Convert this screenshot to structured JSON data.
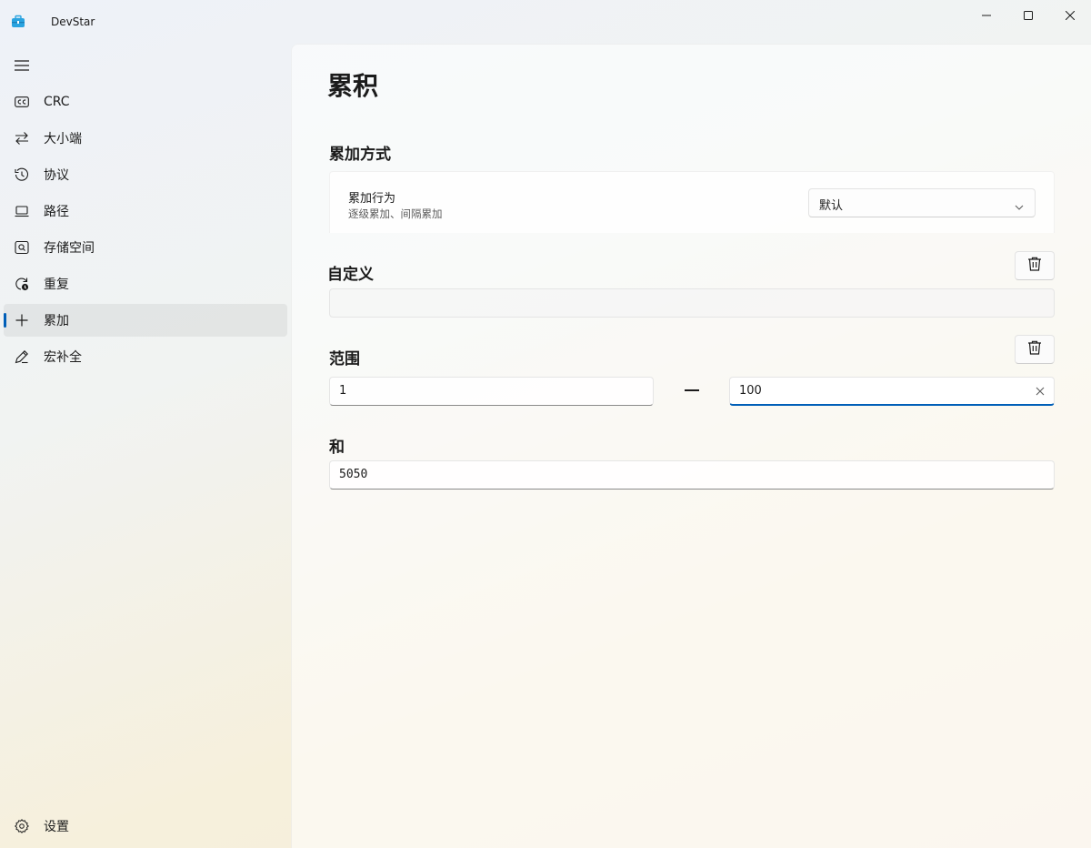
{
  "window": {
    "title": "DevStar",
    "icon": "toolbox-icon",
    "controls": [
      "minimize-icon",
      "maximize-icon",
      "close-icon"
    ]
  },
  "sidebar": {
    "menu_icon": "hamburger-icon",
    "items": [
      {
        "label": "CRC",
        "icon": "cc-icon"
      },
      {
        "label": "大小端",
        "icon": "swap-arrows-icon"
      },
      {
        "label": "协议",
        "icon": "history-icon"
      },
      {
        "label": "路径",
        "icon": "laptop-icon"
      },
      {
        "label": "存储空间",
        "icon": "storage-search-icon"
      },
      {
        "label": "重复",
        "icon": "repeat-icon"
      },
      {
        "label": "累加",
        "icon": "plus-icon",
        "selected": true
      },
      {
        "label": "宏补全",
        "icon": "pen-icon"
      }
    ],
    "settings": {
      "label": "设置",
      "icon": "gear-icon"
    }
  },
  "page": {
    "title": "累积",
    "accumulate_mode": {
      "heading": "累加方式",
      "behavior_title": "累加行为",
      "behavior_desc": "逐级累加、间隔累加",
      "behavior_value": "默认"
    },
    "custom": {
      "heading": "自定义",
      "value": ""
    },
    "range": {
      "heading": "范围",
      "from": "1",
      "to": "100"
    },
    "sum": {
      "heading": "和",
      "value": "5050"
    }
  },
  "colors": {
    "accent": "#005fb8",
    "text": "#1b1b1b",
    "secondary_text": "#5d5d5d"
  }
}
